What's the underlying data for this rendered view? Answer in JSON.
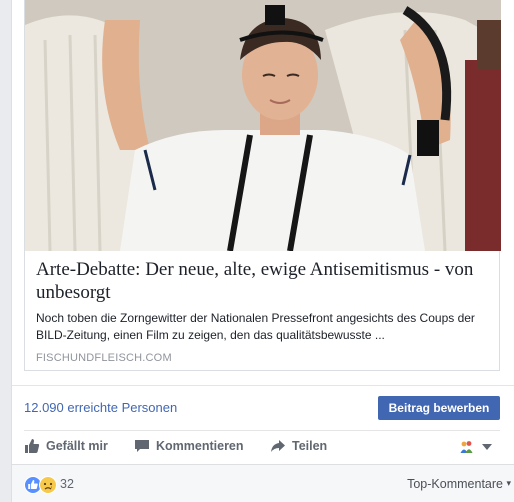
{
  "link_preview": {
    "title": "Arte-Debatte: Der neue, alte, ewige Antisemitismus - von unbesorgt",
    "description": "Noch toben die Zorngewitter der Nationalen Pressefront angesichts des Coups der BILD-Zeitung, einen Film zu zeigen, den das qualitätsbewusste ...",
    "domain": "FISCHUNDFLEISCH.COM"
  },
  "stats": {
    "reach": "12.090 erreichte Personen",
    "boost_label": "Beitrag bewerben"
  },
  "actions": {
    "like": "Gefällt mir",
    "comment": "Kommentieren",
    "share": "Teilen"
  },
  "reactions": {
    "count": "32",
    "sort_label": "Top-Kommentare"
  },
  "colors": {
    "brand_blue": "#4267b2",
    "secondary_text": "#606770"
  }
}
